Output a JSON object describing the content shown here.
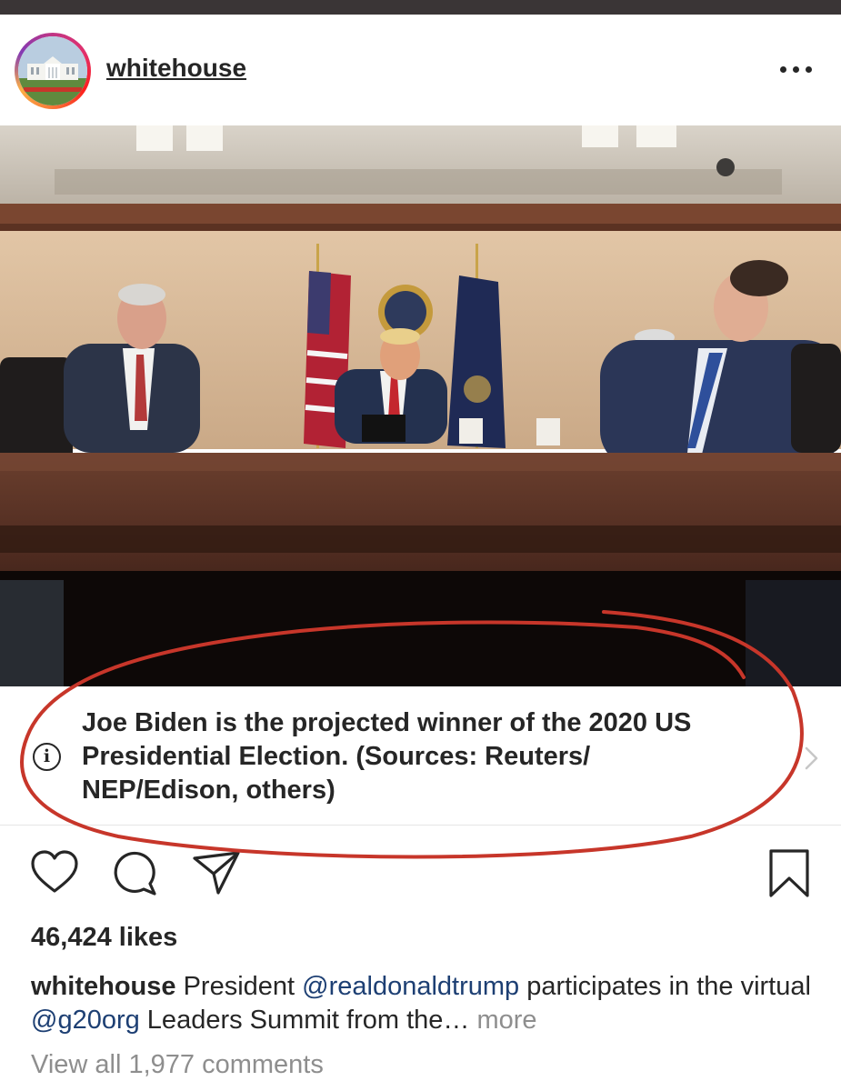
{
  "post": {
    "username": "whitehouse",
    "more_icon": "more-horizontal-icon",
    "avatar_icon": "white-house-building-icon"
  },
  "photo": {
    "description_icon": "post-photo"
  },
  "info_banner": {
    "icon": "info-icon",
    "icon_glyph": "i",
    "text": "Joe Biden is the projected winner of the 2020 US Presidential Election. (Sources: Reuters/ NEP/Edison, others)",
    "chevron_icon": "chevron-right-icon"
  },
  "actions": {
    "like_icon": "heart-icon",
    "comment_icon": "comment-icon",
    "share_icon": "send-icon",
    "save_icon": "bookmark-icon"
  },
  "likes": "46,424 likes",
  "caption": {
    "username": "whitehouse",
    "text_1": " President ",
    "mention_1": "@realdonaldtrump",
    "text_2": " participates in the virtual ",
    "mention_2": "@g20org",
    "text_3": " Leaders Summit from the… ",
    "more": "more"
  },
  "view_comments": "View all 1,977 comments",
  "colors": {
    "mention": "#1d3f73",
    "annotation_red": "#c7362a",
    "muted": "#8e8e8e"
  }
}
